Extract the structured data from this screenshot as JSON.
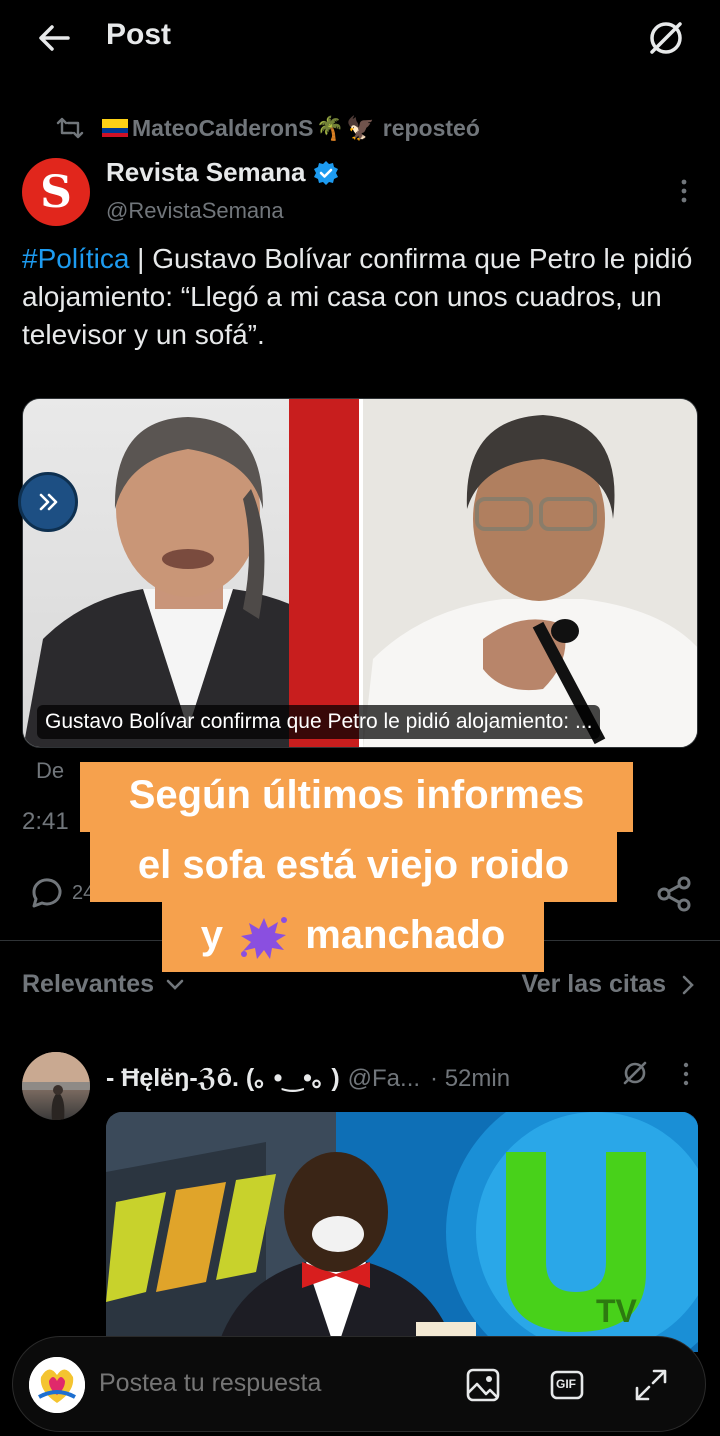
{
  "header": {
    "title": "Post",
    "back_icon": "arrow-left-icon",
    "grok_icon": "grok-icon"
  },
  "repost": {
    "text": "MateoCalderonS",
    "suffix": "reposteó"
  },
  "tweet": {
    "author_name": "Revista Semana",
    "author_handle": "@RevistaSemana",
    "avatar_letter": "S",
    "hashtag": "#Política",
    "text": " | Gustavo Bolívar confirma que Petro le pidió alojamiento: “Llegó a mi casa con unos cuadros, un televisor y un sofá”.",
    "media_caption": "Gustavo Bolívar confirma que Petro le pidió alojamiento: ...",
    "source": "De",
    "time": "2:41",
    "reply_count": "24"
  },
  "overlay": {
    "line1": "Según últimos informes",
    "line2": "el sofa está viejo roido",
    "line3_pre": "y",
    "line3_post": "manchado"
  },
  "replies_bar": {
    "sort_label": "Relevantes",
    "quotes_label": "Ver las citas"
  },
  "reply": {
    "name": "- Ħęlëŋ-ℨȏ. (｡ •‿•｡ )",
    "handle": "@Fa...",
    "time": "· 52min"
  },
  "composer": {
    "placeholder": "Postea tu respuesta",
    "gif_label": "GIF"
  },
  "colors": {
    "accent": "#1d9bf0",
    "overlay": "#f6a14d",
    "semana_red": "#e1261c"
  }
}
